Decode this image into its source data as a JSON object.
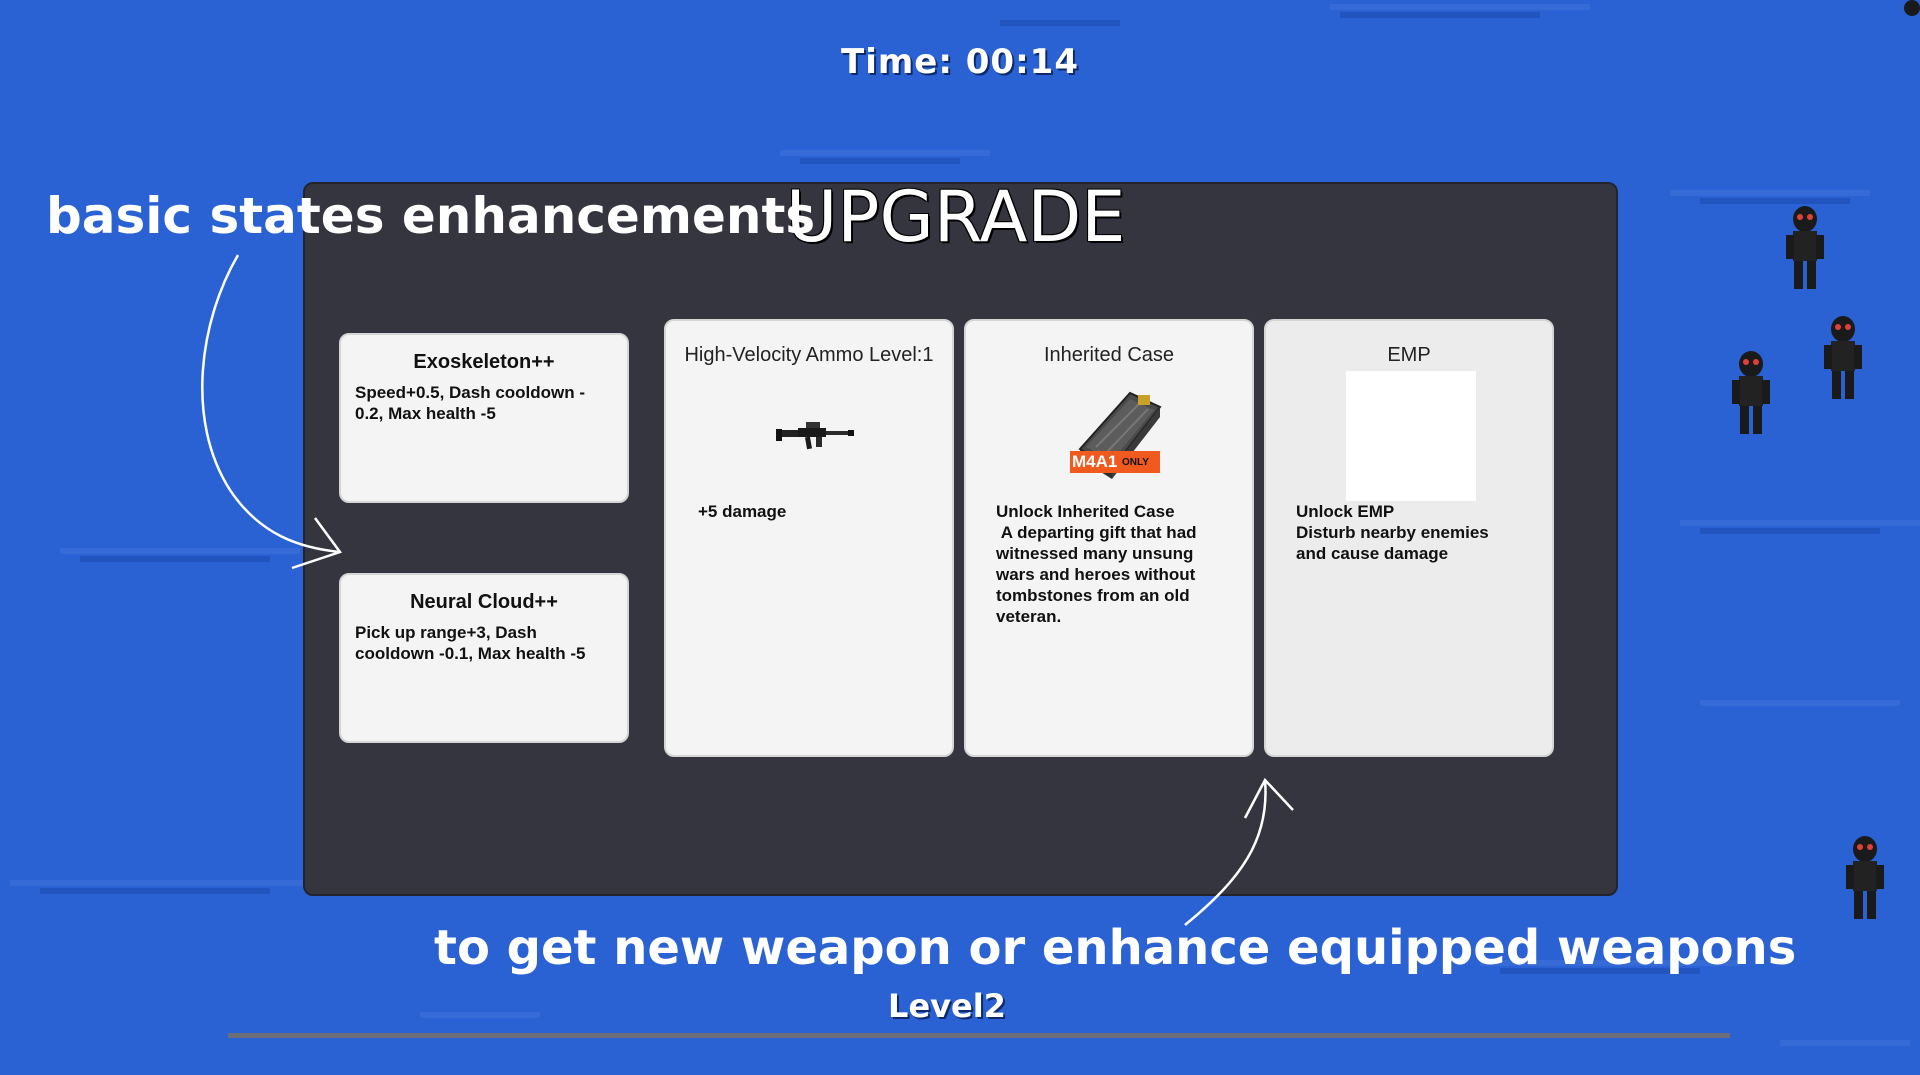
{
  "hud": {
    "timer": "Time: 00:14",
    "level": "Level2",
    "xp_progress": 0
  },
  "panel": {
    "title": "UPGRADE"
  },
  "cards": [
    {
      "title": "Exoskeleton++",
      "description": "Speed+0.5, Dash cooldown -\n0.2, Max health -5",
      "icon": "none"
    },
    {
      "title": "Neural Cloud++",
      "description": "Pick up range+3, Dash\ncooldown -0.1, Max health -5",
      "icon": "none"
    },
    {
      "title": "High-Velocity Ammo Level:1",
      "description": "+5 damage",
      "icon": "rifle-icon"
    },
    {
      "title": "Inherited Case",
      "description": "Unlock Inherited Case\n A departing gift that had\nwitnessed many unsung\nwars and heroes without\ntombstones from an old\nveteran.",
      "icon": "weapon-case-icon",
      "icon_text": "M4A1",
      "icon_subtext": "ONLY"
    },
    {
      "title": "EMP",
      "description": "Unlock EMP\nDisturb nearby enemies\nand cause damage",
      "icon": "blank-image"
    }
  ],
  "annotations": {
    "left": "basic states enhancements",
    "bottom": "to get new weapon or enhance equipped weapons"
  },
  "colors": {
    "background": "#2a62d4",
    "panel": "#34353f",
    "card": "#f4f4f4",
    "case_label": "#f05a1e"
  }
}
